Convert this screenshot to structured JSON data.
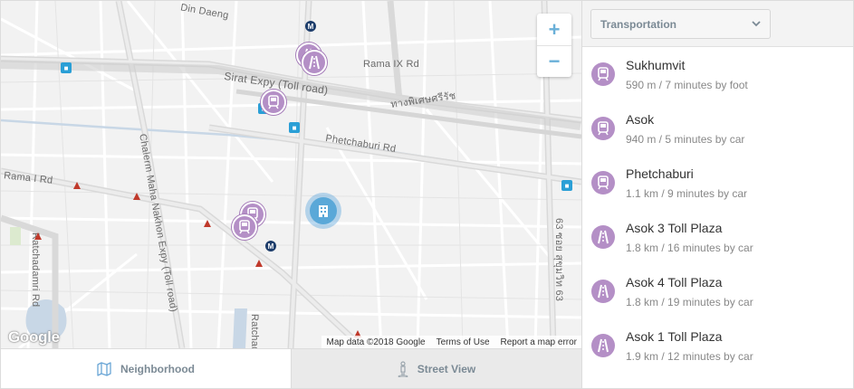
{
  "map": {
    "road_labels": {
      "din_daeng": "Din Daeng",
      "rama_ix": "Rama IX Rd",
      "sirat": "Sirat Expy (Toll road)",
      "thai_road": "ทางพิเศษศรีรัช",
      "phetchaburi_rd": "Phetchaburi Rd",
      "rama_i": "Rama I Rd",
      "chalerm": "Chalerm Maha Nakhon Expy (Toll road)",
      "ratchadamri": "Ratchadamri Rd",
      "ratchada": "Ratchada",
      "soi_thai": "ซอย สุขุมวิท 63",
      "soi_num": "63"
    },
    "zoom_in": "+",
    "zoom_out": "−",
    "google_logo": "Google",
    "attribution": {
      "map_data": "Map data ©2018 Google",
      "terms": "Terms of Use",
      "report": "Report a map error"
    },
    "metro_letter": "M",
    "accent_color": "#b48fc6",
    "home_color": "#5aa8d8"
  },
  "tabs": {
    "neighborhood": "Neighborhood",
    "street_view": "Street View"
  },
  "panel": {
    "category": "Transportation",
    "items": [
      {
        "name": "Sukhumvit",
        "dist": "590 m / 7 minutes by foot",
        "icon": "train-icon"
      },
      {
        "name": "Asok",
        "dist": "940 m / 5 minutes by car",
        "icon": "train-icon"
      },
      {
        "name": "Phetchaburi",
        "dist": "1.1 km / 9 minutes by car",
        "icon": "train-icon"
      },
      {
        "name": "Asok 3 Toll Plaza",
        "dist": "1.8 km / 16 minutes by car",
        "icon": "road-icon"
      },
      {
        "name": "Asok 4 Toll Plaza",
        "dist": "1.8 km / 19 minutes by car",
        "icon": "road-icon"
      },
      {
        "name": "Asok 1 Toll Plaza",
        "dist": "1.9 km / 12 minutes by car",
        "icon": "road-icon"
      }
    ]
  }
}
